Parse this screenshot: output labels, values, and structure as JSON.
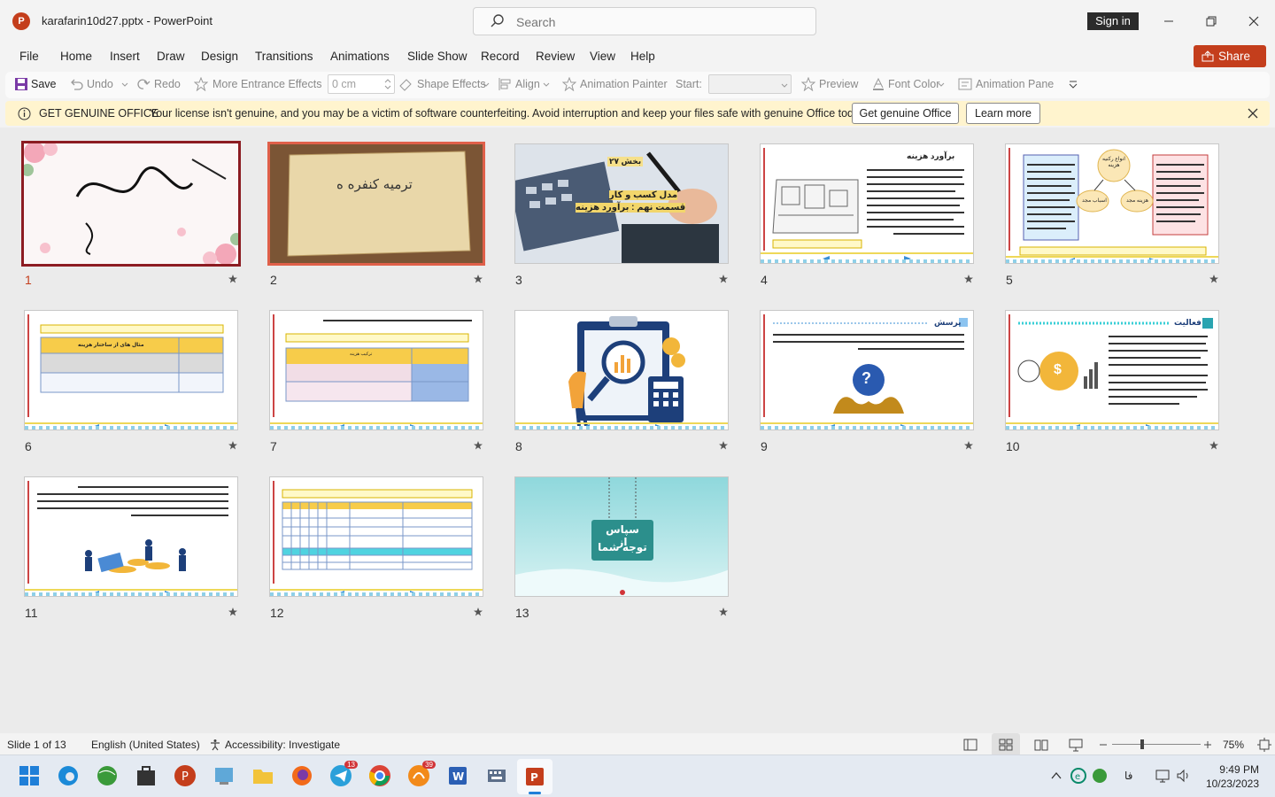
{
  "window": {
    "app_icon": "P",
    "title": "karafarin10d27.pptx  -  PowerPoint",
    "sign_in": "Sign in"
  },
  "search": {
    "placeholder": "Search"
  },
  "menu": [
    "File",
    "Home",
    "Insert",
    "Draw",
    "Design",
    "Transitions",
    "Animations",
    "Slide Show",
    "Record",
    "Review",
    "View",
    "Help"
  ],
  "share": "Share",
  "ribbon": {
    "save": "Save",
    "undo": "Undo",
    "redo": "Redo",
    "more_entrance": "More Entrance Effects",
    "spin_value": "0 cm",
    "shape_effects": "Shape Effects",
    "align": "Align",
    "animation_painter": "Animation Painter",
    "start_label": "Start:",
    "preview": "Preview",
    "font_color": "Font Color",
    "animation_pane": "Animation Pane"
  },
  "message_bar": {
    "title": "GET GENUINE OFFICE",
    "text": "Your license isn't genuine, and you may be a victim of software counterfeiting. Avoid interruption and keep your files safe with genuine Office today.",
    "btn_genuine": "Get genuine Office",
    "btn_learn": "Learn more"
  },
  "slides": [
    {
      "num": "1",
      "texts": {
        "calligraphy": "بسم الله الرحمن الرحیم"
      }
    },
    {
      "num": "2",
      "texts": {
        "title": "ترمیه کنفره ه"
      }
    },
    {
      "num": "3",
      "texts": {
        "line1": "بخش ۲۷",
        "line2": "مدل کسب و کار",
        "line3": "قسمت نهم : برآورد هزینه"
      }
    },
    {
      "num": "4",
      "texts": {
        "title": "برآورد هزینه"
      }
    },
    {
      "num": "5",
      "texts": {
        "circle": "انواع رکنیه هزینه",
        "left": "اسباب مجد",
        "right": "هزینه مجد"
      }
    },
    {
      "num": "6",
      "texts": {
        "header": "مثال های از ساختار هزینه"
      }
    },
    {
      "num": "7",
      "texts": {
        "header": "ترکیب هزینه"
      }
    },
    {
      "num": "8",
      "texts": {}
    },
    {
      "num": "9",
      "texts": {
        "title": "پرسش"
      }
    },
    {
      "num": "10",
      "texts": {
        "title": "فعالیت"
      }
    },
    {
      "num": "11",
      "texts": {}
    },
    {
      "num": "12",
      "texts": {}
    },
    {
      "num": "13",
      "texts": {
        "line1": "سپاس از",
        "line2": "توجه شما"
      }
    }
  ],
  "footer_text": "کارگاه کارآفرینی و تولید",
  "status": {
    "slide": "Slide 1 of 13",
    "language": "English (United States)",
    "accessibility": "Accessibility: Investigate",
    "zoom": "75%"
  },
  "taskbar": {
    "badge_telegram": "13",
    "badge_other": "39",
    "time": "9:49 PM",
    "date": "10/23/2023",
    "lang": "فا"
  },
  "colors": {
    "brand": "#c43e1c",
    "selected_border": "#8c1c22",
    "message_bg": "#fff4ce"
  }
}
